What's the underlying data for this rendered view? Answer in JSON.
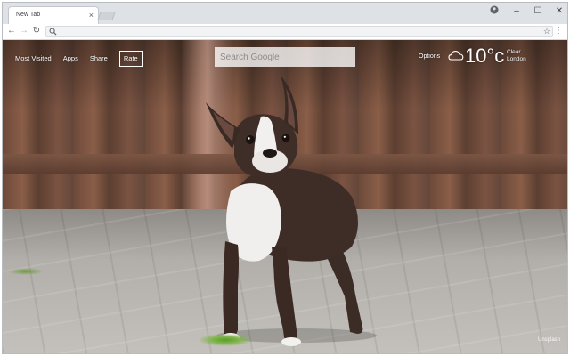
{
  "browser": {
    "tab": {
      "title": "New Tab",
      "close_glyph": "×"
    },
    "window_controls": {
      "minimize": "–",
      "maximize": "☐",
      "close": "✕"
    },
    "toolbar": {
      "back_glyph": "←",
      "forward_glyph": "→",
      "reload_glyph": "↻",
      "address_value": "",
      "star_glyph": "☆",
      "menu_glyph": "⋮"
    }
  },
  "newtab": {
    "links": {
      "most_visited": "Most Visited",
      "apps": "Apps",
      "share": "Share",
      "rate": "Rate"
    },
    "search": {
      "placeholder": "Search Google"
    },
    "options": "Options",
    "weather": {
      "temperature": "10°c",
      "condition": "Clear",
      "location": "London",
      "icon": "cloud-icon"
    },
    "credit": "Unsplash"
  },
  "colors": {
    "chrome_bg": "#dee1e6",
    "toolbar_bg": "#ffffff",
    "overlay_text": "#ffffff",
    "search_bg": "rgba(255,255,255,0.78)"
  }
}
